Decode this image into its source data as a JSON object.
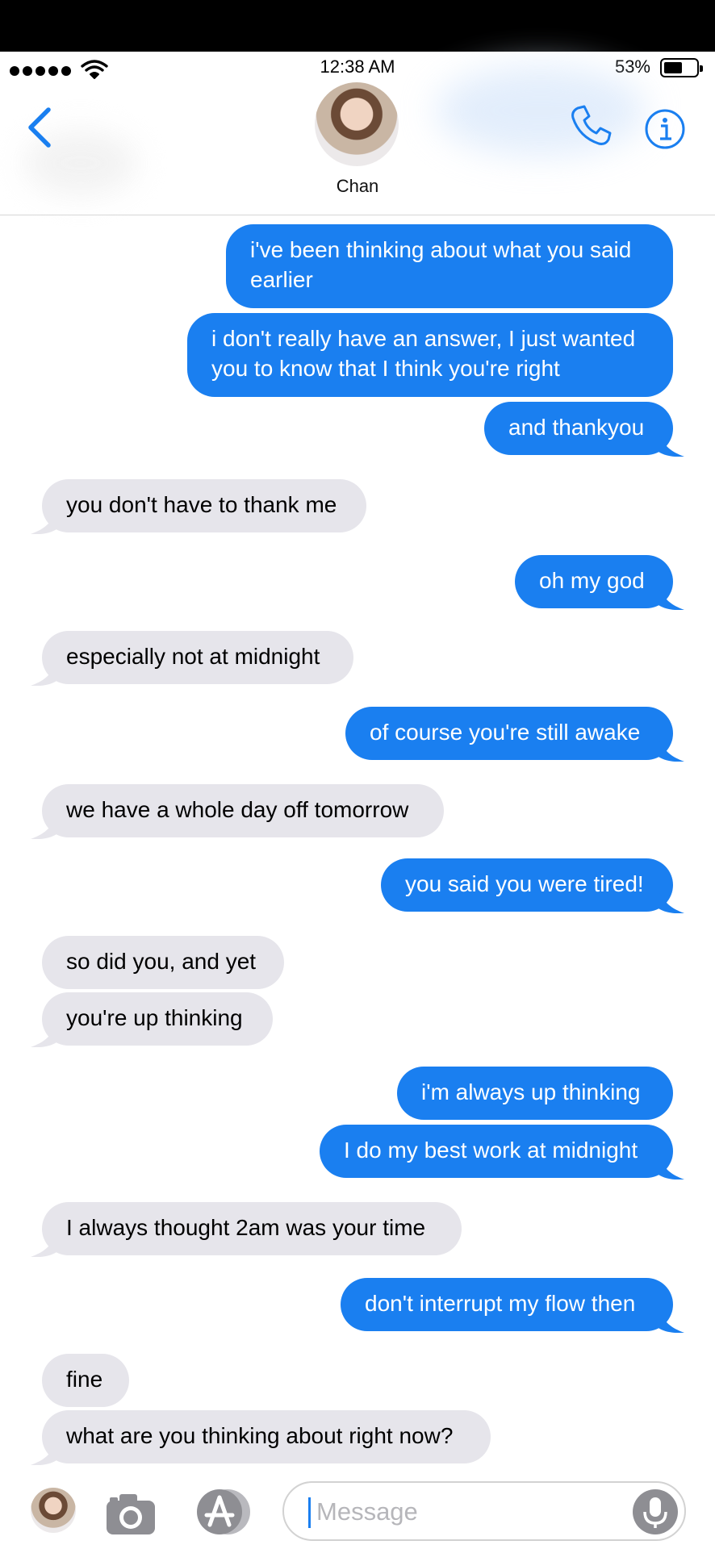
{
  "status_bar": {
    "time": "12:38 AM",
    "battery_percent": "53%",
    "battery_level": 0.53
  },
  "header": {
    "contact_name": "Chan"
  },
  "messages": [
    {
      "text": "i've been thinking about what you said\nearlier",
      "direction": "outgoing"
    },
    {
      "text": "i don't really have an answer, I just wanted\nyou to know that I think you're right",
      "direction": "outgoing"
    },
    {
      "text": "and thankyou",
      "direction": "outgoing"
    },
    {
      "text": "you don't have to thank me",
      "direction": "incoming"
    },
    {
      "text": "oh my god",
      "direction": "outgoing"
    },
    {
      "text": "especially not at midnight",
      "direction": "incoming"
    },
    {
      "text": "of course you're still awake",
      "direction": "outgoing"
    },
    {
      "text": "we have a whole day off tomorrow",
      "direction": "incoming"
    },
    {
      "text": "you said you were tired!",
      "direction": "outgoing"
    },
    {
      "text": "so did you, and yet",
      "direction": "incoming"
    },
    {
      "text": "you're up thinking",
      "direction": "incoming"
    },
    {
      "text": "i'm always up thinking",
      "direction": "outgoing"
    },
    {
      "text": "I do my best work at midnight",
      "direction": "outgoing"
    },
    {
      "text": "I always thought 2am was your time",
      "direction": "incoming"
    },
    {
      "text": "don't interrupt my flow then",
      "direction": "outgoing"
    },
    {
      "text": "fine",
      "direction": "incoming"
    },
    {
      "text": "what are you thinking about right now?",
      "direction": "incoming"
    }
  ],
  "composer": {
    "placeholder": "Message"
  },
  "icons": {
    "back": "chevron-left-icon",
    "call": "phone-icon",
    "info": "info-icon",
    "camera": "camera-icon",
    "apps": "app-store-icon",
    "mic": "microphone-icon"
  },
  "colors": {
    "accent": "#1a7ff0",
    "incoming_bubble": "#e6e5eb"
  }
}
